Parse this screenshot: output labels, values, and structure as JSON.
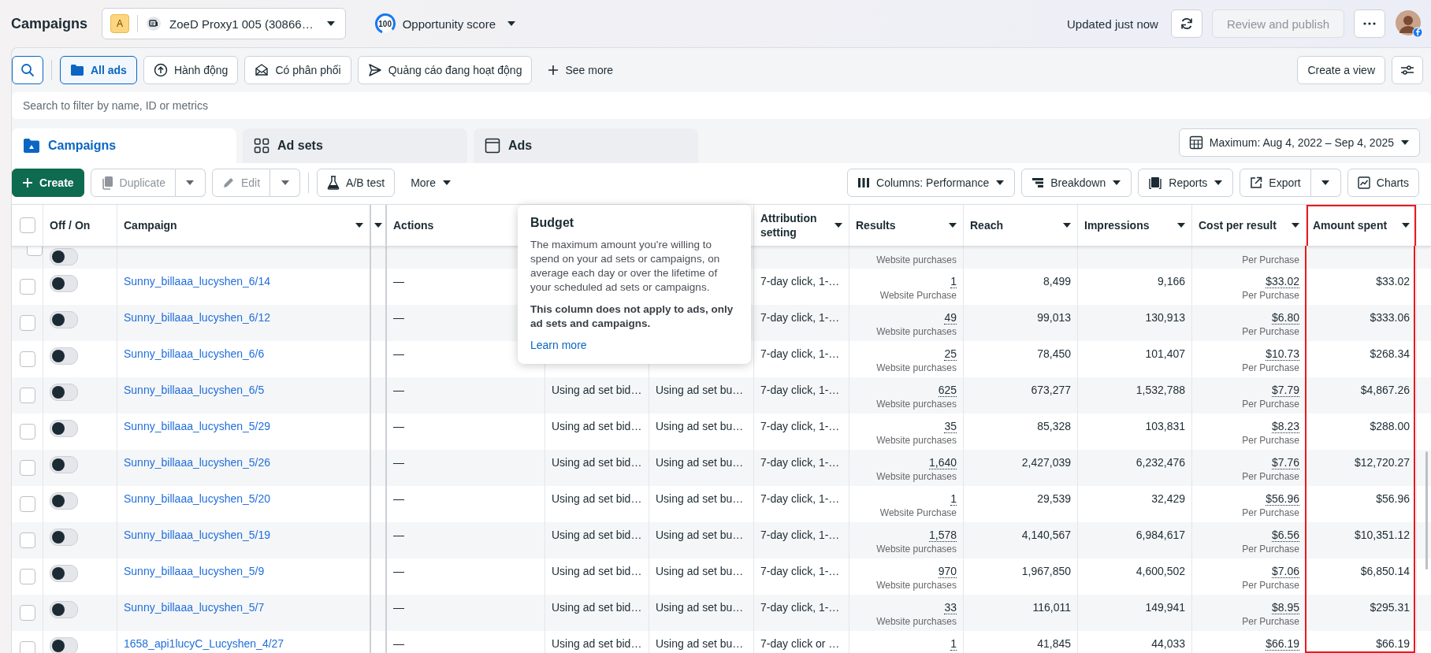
{
  "header": {
    "title": "Campaigns",
    "account": {
      "badge": "A",
      "name": "ZoeD Proxy1 005 (30866…"
    },
    "score": {
      "value": "100",
      "label": "Opportunity score"
    },
    "status": "Updated just now",
    "publish_button": {
      "label": "Review and publish",
      "disabled": true
    }
  },
  "filters": [
    {
      "label": "All ads",
      "selected": true,
      "kind": "folder"
    },
    {
      "label": "Hành động",
      "selected": false,
      "kind": "upload"
    },
    {
      "label": "Có phân phối",
      "selected": false,
      "kind": "mail"
    },
    {
      "label": "Quảng cáo đang hoạt động",
      "selected": false,
      "kind": "send"
    }
  ],
  "see_more": "See more",
  "create_view": "Create a view",
  "search": {
    "placeholder": "Search to filter by name, ID or metrics"
  },
  "tabs": [
    {
      "label": "Campaigns",
      "selected": true,
      "kind": "folder"
    },
    {
      "label": "Ad sets",
      "selected": false,
      "kind": "grid"
    },
    {
      "label": "Ads",
      "selected": false,
      "kind": "window"
    }
  ],
  "date_range": "Maximum: Aug 4, 2022 – Sep 4, 2025",
  "toolbar": {
    "create": "Create",
    "duplicate": {
      "label": "Duplicate",
      "disabled": true
    },
    "edit": {
      "label": "Edit",
      "disabled": true
    },
    "ab_test": "A/B test",
    "more": "More",
    "columns": "Columns: Performance",
    "breakdown": "Breakdown",
    "reports": "Reports",
    "export": "Export",
    "charts": "Charts"
  },
  "table": {
    "select_all": {
      "checked": false
    },
    "columns": [
      {
        "label": "Off / On",
        "sortable": false,
        "highlighted": false
      },
      {
        "label": "Campaign",
        "sortable": true,
        "highlighted": false
      },
      {
        "sortable": true,
        "highlighted": false
      },
      {
        "label": "Actions",
        "highlighted": false
      },
      {
        "label": "Attribution setting",
        "sortable": true,
        "highlighted": false
      },
      {
        "label": "Results",
        "sortable": true,
        "highlighted": false
      },
      {
        "label": "Reach",
        "sortable": true,
        "highlighted": false
      },
      {
        "label": "Impressions",
        "sortable": true,
        "highlighted": false
      },
      {
        "label": "Cost per result",
        "sortable": true,
        "highlighted": false
      },
      {
        "label": "Amount spent",
        "sortable": true,
        "highlighted": true
      }
    ],
    "rows": [
      {
        "checked": false,
        "on": false,
        "results_type": "Website purchases",
        "cost_type": "Per Purchase"
      },
      {
        "checked": false,
        "on": false,
        "campaign": "Sunny_billaaa_lucyshen_6/14",
        "actions": "—",
        "attribution": "7-day click, 1-…",
        "results": "1",
        "results_type": "Website Purchase",
        "reach": "8,499",
        "impressions": "9,166",
        "cost_per_result": "$33.02",
        "cost_type": "Per Purchase",
        "amount_spent": "$33.02"
      },
      {
        "checked": false,
        "on": false,
        "campaign": "Sunny_billaaa_lucyshen_6/12",
        "actions": "—",
        "attribution": "7-day click, 1-…",
        "results": "49",
        "results_type": "Website purchases",
        "reach": "99,013",
        "impressions": "130,913",
        "cost_per_result": "$6.80",
        "cost_type": "Per Purchase",
        "amount_spent": "$333.06"
      },
      {
        "checked": false,
        "on": false,
        "campaign": "Sunny_billaaa_lucyshen_6/6",
        "actions": "—",
        "attribution": "7-day click, 1-…",
        "results": "25",
        "results_type": "Website purchases",
        "reach": "78,450",
        "impressions": "101,407",
        "cost_per_result": "$10.73",
        "cost_type": "Per Purchase",
        "amount_spent": "$268.34"
      },
      {
        "checked": false,
        "on": false,
        "campaign": "Sunny_billaaa_lucyshen_6/5",
        "actions": "—",
        "bid_strategy": "Using ad set bid…",
        "budget": "Using ad set bu…",
        "attribution": "7-day click, 1-…",
        "results": "625",
        "results_type": "Website purchases",
        "reach": "673,277",
        "impressions": "1,532,788",
        "cost_per_result": "$7.79",
        "cost_type": "Per Purchase",
        "amount_spent": "$4,867.26"
      },
      {
        "checked": false,
        "on": false,
        "campaign": "Sunny_billaaa_lucyshen_5/29",
        "actions": "—",
        "bid_strategy": "Using ad set bid…",
        "budget": "Using ad set bu…",
        "attribution": "7-day click, 1-…",
        "results": "35",
        "results_type": "Website purchases",
        "reach": "85,328",
        "impressions": "103,831",
        "cost_per_result": "$8.23",
        "cost_type": "Per Purchase",
        "amount_spent": "$288.00"
      },
      {
        "checked": false,
        "on": false,
        "campaign": "Sunny_billaaa_lucyshen_5/26",
        "actions": "—",
        "bid_strategy": "Using ad set bid…",
        "budget": "Using ad set bu…",
        "attribution": "7-day click, 1-…",
        "results": "1,640",
        "results_type": "Website purchases",
        "reach": "2,427,039",
        "impressions": "6,232,476",
        "cost_per_result": "$7.76",
        "cost_type": "Per Purchase",
        "amount_spent": "$12,720.27"
      },
      {
        "checked": false,
        "on": false,
        "campaign": "Sunny_billaaa_lucyshen_5/20",
        "actions": "—",
        "bid_strategy": "Using ad set bid…",
        "budget": "Using ad set bu…",
        "attribution": "7-day click, 1-…",
        "results": "1",
        "results_type": "Website Purchase",
        "reach": "29,539",
        "impressions": "32,429",
        "cost_per_result": "$56.96",
        "cost_type": "Per Purchase",
        "amount_spent": "$56.96"
      },
      {
        "checked": false,
        "on": false,
        "campaign": "Sunny_billaaa_lucyshen_5/19",
        "actions": "—",
        "bid_strategy": "Using ad set bid…",
        "budget": "Using ad set bu…",
        "attribution": "7-day click, 1-…",
        "results": "1,578",
        "results_type": "Website purchases",
        "reach": "4,140,567",
        "impressions": "6,984,617",
        "cost_per_result": "$6.56",
        "cost_type": "Per Purchase",
        "amount_spent": "$10,351.12"
      },
      {
        "checked": false,
        "on": false,
        "campaign": "Sunny_billaaa_lucyshen_5/9",
        "actions": "—",
        "bid_strategy": "Using ad set bid…",
        "budget": "Using ad set bu…",
        "attribution": "7-day click, 1-…",
        "results": "970",
        "results_type": "Website purchases",
        "reach": "1,967,850",
        "impressions": "4,600,502",
        "cost_per_result": "$7.06",
        "cost_type": "Per Purchase",
        "amount_spent": "$6,850.14"
      },
      {
        "checked": false,
        "on": false,
        "campaign": "Sunny_billaaa_lucyshen_5/7",
        "actions": "—",
        "bid_strategy": "Using ad set bid…",
        "budget": "Using ad set bu…",
        "attribution": "7-day click, 1-…",
        "results": "33",
        "results_type": "Website purchases",
        "reach": "116,011",
        "impressions": "149,941",
        "cost_per_result": "$8.95",
        "cost_type": "Per Purchase",
        "amount_spent": "$295.31"
      },
      {
        "checked": false,
        "on": false,
        "campaign": "1658_api1lucyC_Lucyshen_4/27",
        "actions": "—",
        "bid_strategy": "Using ad set bid…",
        "budget": "Using ad set bu…",
        "attribution": "7-day click or …",
        "results": "1",
        "reach": "41,845",
        "impressions": "44,033",
        "cost_per_result": "$66.19",
        "amount_spent": "$66.19"
      }
    ]
  },
  "tooltip": {
    "title": "Budget",
    "text": "The maximum amount you're willing to spend on your ad sets or campaigns, on average each day or over the lifetime of your scheduled ad sets or campaigns.",
    "note": "This column does not apply to ads, only ad sets and campaigns.",
    "link": "Learn more"
  }
}
